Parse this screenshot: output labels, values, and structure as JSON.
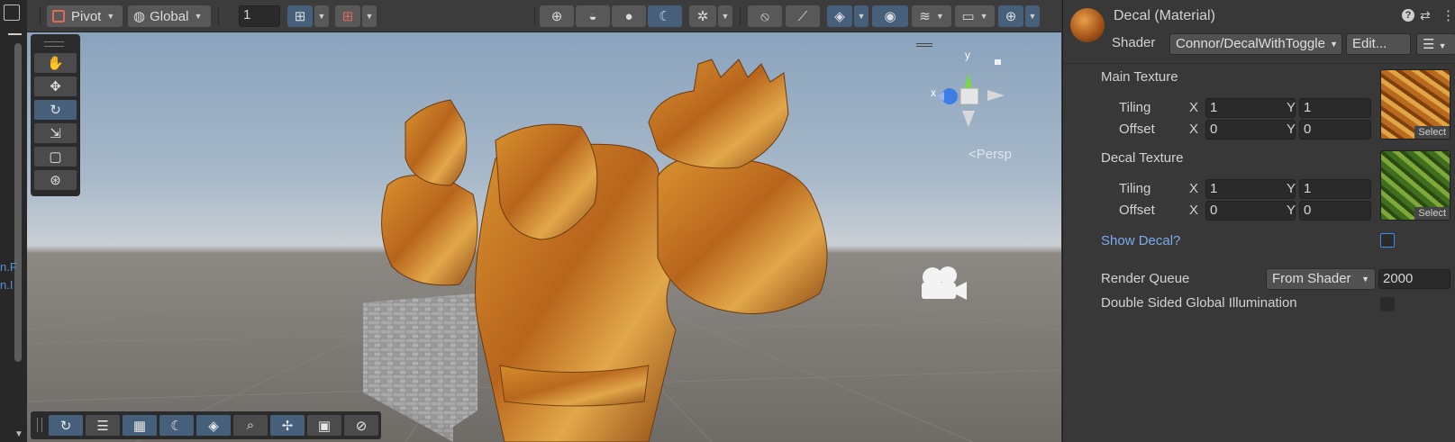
{
  "left_strip": {
    "fragments": [
      "n.F",
      "n.I"
    ]
  },
  "toolbar": {
    "pivot_label": "Pivot",
    "global_label": "Global",
    "grid_value": "1"
  },
  "viewport": {
    "gizmo": {
      "y_label": "y",
      "x_label": "x",
      "projection_label": "<Persp"
    }
  },
  "inspector": {
    "title": "Decal (Material)",
    "shader_label": "Shader",
    "shader_value": "Connor/DecalWithToggle",
    "edit_button": "Edit...",
    "main_texture": {
      "label": "Main Texture",
      "tiling_label": "Tiling",
      "offset_label": "Offset",
      "tiling_x": "1",
      "tiling_y": "1",
      "offset_x": "0",
      "offset_y": "0",
      "select_label": "Select"
    },
    "decal_texture": {
      "label": "Decal Texture",
      "tiling_label": "Tiling",
      "offset_label": "Offset",
      "tiling_x": "1",
      "tiling_y": "1",
      "offset_x": "0",
      "offset_y": "0",
      "select_label": "Select"
    },
    "axis_x": "X",
    "axis_y": "Y",
    "show_decal_label": "Show Decal?",
    "render_queue_label": "Render Queue",
    "render_queue_mode": "From Shader",
    "render_queue_value": "2000",
    "gi_label": "Double Sided Global Illumination"
  },
  "colors": {
    "accent": "#46607c",
    "link": "#7bacf2",
    "focus": "#3d8cf0"
  }
}
